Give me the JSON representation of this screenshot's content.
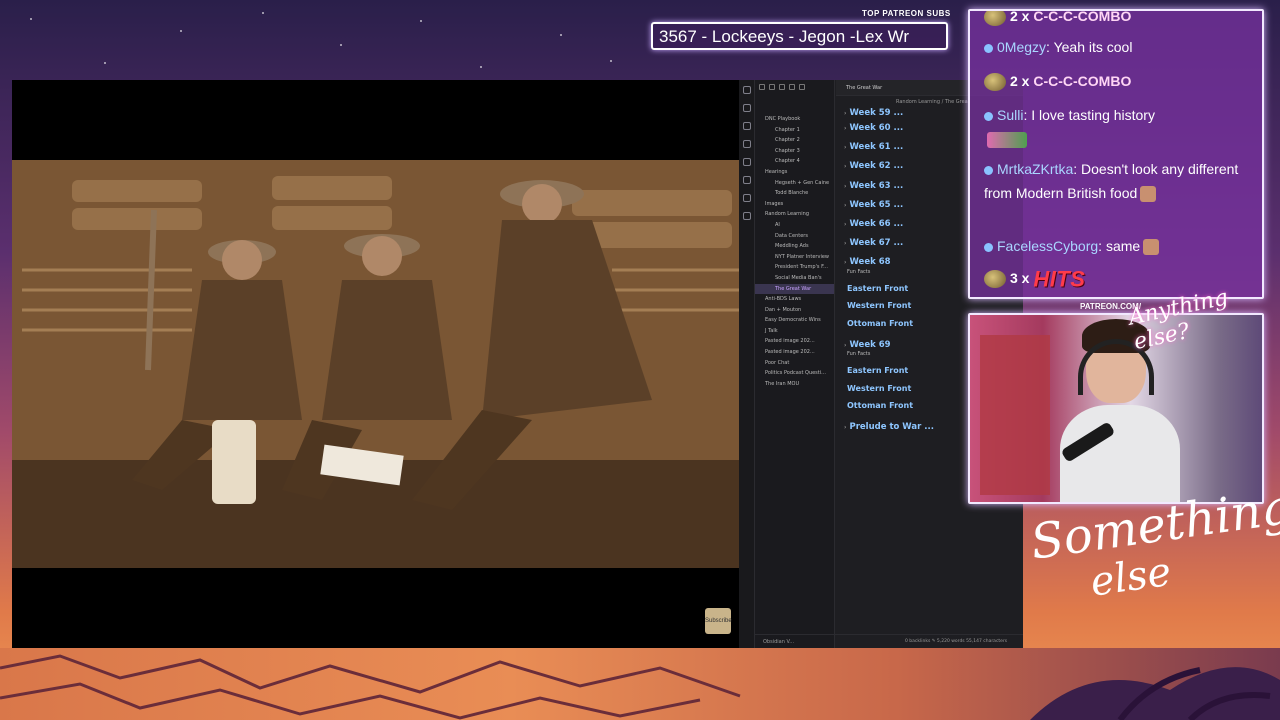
{
  "overlay": {
    "top_patreon_label": "TOP PATREON SUBS",
    "top_patreon_names": "3567 - Lockeeys - Jegon -Lex Wr",
    "patreon_url": "PATREON.COM/",
    "signature": "Anything else?",
    "brand_line1": "Something",
    "brand_line2": "else"
  },
  "video": {
    "subscribe_badge": "Subscribe"
  },
  "obsidian": {
    "tab_title": "The Great War",
    "breadcrumb": "Random Learning  /  The Great",
    "vault_name": "Obsidian V...",
    "status": "0 backlinks   ✎   5,220 words   55,147 characters",
    "tree": [
      {
        "label": "DNC Playbook",
        "level": 0
      },
      {
        "label": "Chapter 1",
        "level": 1
      },
      {
        "label": "Chapter 2",
        "level": 1
      },
      {
        "label": "Chapter 3",
        "level": 1
      },
      {
        "label": "Chapter 4",
        "level": 1
      },
      {
        "label": "Hearings",
        "level": 0
      },
      {
        "label": "Hegseth + Gen Caine",
        "level": 1
      },
      {
        "label": "Todd Blanche",
        "level": 1
      },
      {
        "label": "Images",
        "level": 0
      },
      {
        "label": "Random Learning",
        "level": 0
      },
      {
        "label": "AI",
        "level": 1
      },
      {
        "label": "Data Centers",
        "level": 1
      },
      {
        "label": "Meddling Ads",
        "level": 1
      },
      {
        "label": "NYT Platner Interview",
        "level": 1
      },
      {
        "label": "President Trump's F...",
        "level": 1
      },
      {
        "label": "Social Media Ban's",
        "level": 1
      },
      {
        "label": "The Great War",
        "level": 1,
        "active": true
      },
      {
        "label": "Anti-BDS Laws",
        "level": 0
      },
      {
        "label": "Dan + Mouton",
        "level": 0
      },
      {
        "label": "Easy Democratic Wins",
        "level": 0
      },
      {
        "label": "J Talk",
        "level": 0
      },
      {
        "label": "Pasted image 202...",
        "level": 0
      },
      {
        "label": "Pasted image 202...",
        "level": 0
      },
      {
        "label": "Poor Chat",
        "level": 0
      },
      {
        "label": "Politics Podcast Questi...",
        "level": 0
      },
      {
        "label": "The Iran MOU",
        "level": 0
      }
    ],
    "outline": {
      "week59": "Week 59 ...",
      "week60": "Week 60 ...",
      "week61": "Week 61 ...",
      "week62": "Week 62 ...",
      "week63": "Week 63 ...",
      "week65": "Week 65 ...",
      "week66": "Week 66 ...",
      "week67": "Week 67 ...",
      "week68": "Week 68",
      "fun_facts_1": "Fun Facts",
      "eastern_1": "Eastern Front",
      "western_1": "Western Front",
      "ottoman_1": "Ottoman Front",
      "week69": "Week 69",
      "fun_facts_2": "Fun Facts",
      "eastern_2": "Eastern Front",
      "western_2": "Western Front",
      "ottoman_2": "Ottoman Front",
      "prelude": "Prelude to War ..."
    }
  },
  "chat": {
    "messages": [
      {
        "id": "m0",
        "prefix": "2 x",
        "text": "C-C-C-COMBO"
      },
      {
        "id": "m1",
        "user": "0Megzy",
        "text": "Yeah its cool"
      },
      {
        "id": "m2",
        "prefix": "2 x",
        "text": "C-C-C-COMBO"
      },
      {
        "id": "m3",
        "user": "Sulli",
        "text": "I love tasting history"
      },
      {
        "id": "m4",
        "user": "MrtkaZKrtka",
        "text": "Doesn't look any different from Modern British food"
      },
      {
        "id": "m5",
        "user": "FacelessCyborg",
        "text": "same"
      },
      {
        "id": "m6",
        "prefix": "3 x",
        "text": "HITS"
      }
    ]
  }
}
